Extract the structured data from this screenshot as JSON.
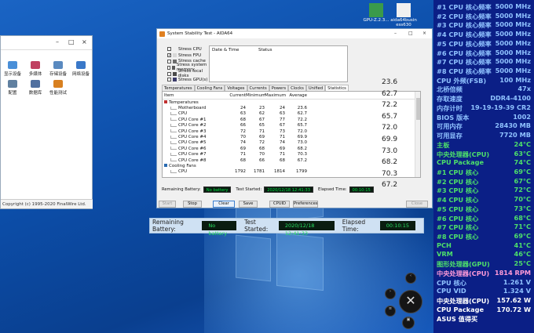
{
  "desktop": {
    "icons": [
      {
        "label": "GPU-Z.2.3...",
        "color": "#3a9a4a"
      },
      {
        "label": "aida64busin ess630",
        "color": "#f0f0f0"
      }
    ]
  },
  "left_window": {
    "title_buttons": [
      "–",
      "□",
      "×"
    ],
    "items": [
      {
        "label": "显示设备",
        "color": "#4a8fd8"
      },
      {
        "label": "多媒体",
        "color": "#c04060"
      },
      {
        "label": "存储设备",
        "color": "#5a8ac0"
      },
      {
        "label": "网络设备",
        "color": "#3a78c8"
      },
      {
        "label": "配置",
        "color": "#6080a0"
      },
      {
        "label": "数据库",
        "color": "#5070a0"
      },
      {
        "label": "性能测试",
        "color": "#d88020"
      }
    ],
    "copyright": "Copyright (c) 1995-2020 FinalWire Ltd."
  },
  "sst": {
    "title": "System Stability Test - AIDA64",
    "window_buttons": [
      "–",
      "□",
      "×"
    ],
    "stress_options": [
      {
        "label": "Stress CPU",
        "checked": false,
        "color": ""
      },
      {
        "label": "Stress FPU",
        "checked": true,
        "color": "#d8d8d8"
      },
      {
        "label": "Stress cache",
        "checked": false,
        "color": "#6d6d6d"
      },
      {
        "label": "Stress system memory",
        "checked": false,
        "color": "#5a5a5a"
      },
      {
        "label": "Stress local disks",
        "checked": false,
        "color": "#4a4a4a"
      },
      {
        "label": "Stress GPU(s)",
        "checked": false,
        "color": "#3a3a6a"
      }
    ],
    "log_headers": {
      "date": "Date & Time",
      "status": "Status"
    },
    "tabs": [
      "Temperatures",
      "Cooling Fans",
      "Voltages",
      "Currents",
      "Powers",
      "Clocks",
      "Unified",
      "Statistics"
    ],
    "active_tab": "Statistics",
    "columns": [
      "Item",
      "Current",
      "Minimum",
      "Maximum",
      "Average"
    ],
    "rows": [
      {
        "type": "group",
        "item": "Temperatures",
        "cur": "",
        "min": "",
        "max": "",
        "avg": "",
        "icon": "#c03030"
      },
      {
        "type": "leaf",
        "item": "Motherboard",
        "cur": "24",
        "min": "23",
        "max": "24",
        "avg": "23.6"
      },
      {
        "type": "leaf",
        "item": "CPU",
        "cur": "63",
        "min": "62",
        "max": "63",
        "avg": "62.7"
      },
      {
        "type": "leaf",
        "item": "CPU Core #1",
        "cur": "68",
        "min": "67",
        "max": "77",
        "avg": "72.2"
      },
      {
        "type": "leaf",
        "item": "CPU Core #2",
        "cur": "66",
        "min": "65",
        "max": "67",
        "avg": "65.7"
      },
      {
        "type": "leaf",
        "item": "CPU Core #3",
        "cur": "72",
        "min": "71",
        "max": "73",
        "avg": "72.0"
      },
      {
        "type": "leaf",
        "item": "CPU Core #4",
        "cur": "70",
        "min": "69",
        "max": "71",
        "avg": "69.9"
      },
      {
        "type": "leaf",
        "item": "CPU Core #5",
        "cur": "74",
        "min": "72",
        "max": "74",
        "avg": "73.0"
      },
      {
        "type": "leaf",
        "item": "CPU Core #6",
        "cur": "69",
        "min": "68",
        "max": "69",
        "avg": "68.2"
      },
      {
        "type": "leaf",
        "item": "CPU Core #7",
        "cur": "71",
        "min": "70",
        "max": "71",
        "avg": "70.3"
      },
      {
        "type": "leaf",
        "item": "CPU Core #8",
        "cur": "68",
        "min": "66",
        "max": "68",
        "avg": "67.2"
      },
      {
        "type": "group",
        "item": "Cooling Fans",
        "cur": "",
        "min": "",
        "max": "",
        "avg": "",
        "icon": "#2a6ab0"
      },
      {
        "type": "leaf",
        "item": "CPU",
        "cur": "1792",
        "min": "1781",
        "max": "1814",
        "avg": "1799"
      }
    ],
    "side_values": [
      "23.6",
      "62.7",
      "72.2",
      "65.7",
      "72.0",
      "69.9",
      "73.0",
      "68.2",
      "70.3",
      "67.2"
    ],
    "status": {
      "battery_label": "Remaining Battery:",
      "battery_value": "No battery",
      "started_label": "Test Started:",
      "started_value": "2020/12/18 12:41:33",
      "elapsed_label": "Elapsed Time:",
      "elapsed_value": "00:10:15"
    },
    "buttons": {
      "start": "Start",
      "stop": "Stop",
      "clear": "Clear",
      "save": "Save",
      "cpuid": "CPUID",
      "preferences": "Preferences",
      "close": "Close"
    }
  },
  "info_strip": {
    "battery_label": "Remaining Battery:",
    "battery_value": "No battery",
    "started_label": "Test Started:",
    "started_value": "2020/12/18 12:41:33",
    "elapsed_label": "Elapsed Time:",
    "elapsed_value": "00:10:15"
  },
  "osd": [
    {
      "k": "#1 CPU 核心频率",
      "v": "5000 MHz",
      "color": "#8fc2ff"
    },
    {
      "k": "#2 CPU 核心频率",
      "v": "5000 MHz",
      "color": "#8fc2ff"
    },
    {
      "k": "#3 CPU 核心频率",
      "v": "5000 MHz",
      "color": "#8fc2ff"
    },
    {
      "k": "#4 CPU 核心频率",
      "v": "5000 MHz",
      "color": "#8fc2ff"
    },
    {
      "k": "#5 CPU 核心频率",
      "v": "5000 MHz",
      "color": "#8fc2ff"
    },
    {
      "k": "#6 CPU 核心频率",
      "v": "5000 MHz",
      "color": "#8fc2ff"
    },
    {
      "k": "#7 CPU 核心频率",
      "v": "5000 MHz",
      "color": "#8fc2ff"
    },
    {
      "k": "#8 CPU 核心频率",
      "v": "5000 MHz",
      "color": "#8fc2ff"
    },
    {
      "k": "CPU 外频(FSB)",
      "v": "100 MHz",
      "color": "#8fc2ff"
    },
    {
      "k": "北桥倍频",
      "v": "47x",
      "color": "#8fc2ff"
    },
    {
      "k": "存取速度",
      "v": "DDR4-4100",
      "color": "#8fc2ff"
    },
    {
      "k": "内存计时",
      "v": "19-19-19-39 CR2",
      "color": "#8fc2ff"
    },
    {
      "k": "BIOS 版本",
      "v": "1002",
      "color": "#8fc2ff"
    },
    {
      "k": "可用内存",
      "v": "28430 MB",
      "color": "#8fc2ff"
    },
    {
      "k": "可用显存",
      "v": "7720 MB",
      "color": "#8fc2ff"
    },
    {
      "k": "主板",
      "v": "24°C",
      "color": "#4de06a"
    },
    {
      "k": "中央处理器(CPU)",
      "v": "63°C",
      "color": "#4de06a"
    },
    {
      "k": "CPU Package",
      "v": "74°C",
      "color": "#4de06a"
    },
    {
      "k": " #1 CPU 核心",
      "v": "69°C",
      "color": "#4de06a"
    },
    {
      "k": " #2 CPU 核心",
      "v": "67°C",
      "color": "#4de06a"
    },
    {
      "k": " #3 CPU 核心",
      "v": "72°C",
      "color": "#4de06a"
    },
    {
      "k": " #4 CPU 核心",
      "v": "70°C",
      "color": "#4de06a"
    },
    {
      "k": " #5 CPU 核心",
      "v": "73°C",
      "color": "#4de06a"
    },
    {
      "k": " #6 CPU 核心",
      "v": "68°C",
      "color": "#4de06a"
    },
    {
      "k": " #7 CPU 核心",
      "v": "71°C",
      "color": "#4de06a"
    },
    {
      "k": " #8 CPU 核心",
      "v": "69°C",
      "color": "#4de06a"
    },
    {
      "k": "PCH",
      "v": "41°C",
      "color": "#4de06a"
    },
    {
      "k": "VRM",
      "v": "46°C",
      "color": "#4de06a"
    },
    {
      "k": "图形处理器(GPU)",
      "v": "25°C",
      "color": "#4de06a"
    },
    {
      "k": "中央处理器(CPU)",
      "v": "1814 RPM",
      "color": "#ff9ad8"
    },
    {
      "k": "CPU 核心",
      "v": "1.261 V",
      "color": "#8fc2ff"
    },
    {
      "k": "CPU VID",
      "v": "1.324 V",
      "color": "#8fc2ff"
    },
    {
      "k": "中央处理器(CPU)",
      "v": "157.62 W",
      "color": "#ffffff"
    },
    {
      "k": "CPU Package",
      "v": "170.72 W",
      "color": "#ffffff"
    },
    {
      "k": "ASUS 值得买",
      "v": "",
      "color": "#ffffff"
    }
  ],
  "gadget": {
    "buttons": [
      "‹",
      "›",
      "≡",
      "▣"
    ]
  }
}
